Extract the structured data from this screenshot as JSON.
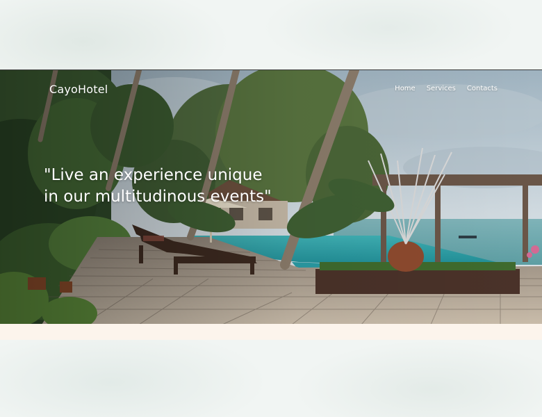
{
  "brand": {
    "logo_text": "CayoHotel"
  },
  "nav": {
    "items": [
      {
        "label": "Home"
      },
      {
        "label": "Services"
      },
      {
        "label": "Contacts"
      }
    ]
  },
  "hero": {
    "headline": "\"Live an experience unique in our multitudinous events\""
  },
  "colors": {
    "page_background": "#f1f5f3",
    "strip": "#fcf4ec",
    "text_on_image": "#ffffff"
  }
}
